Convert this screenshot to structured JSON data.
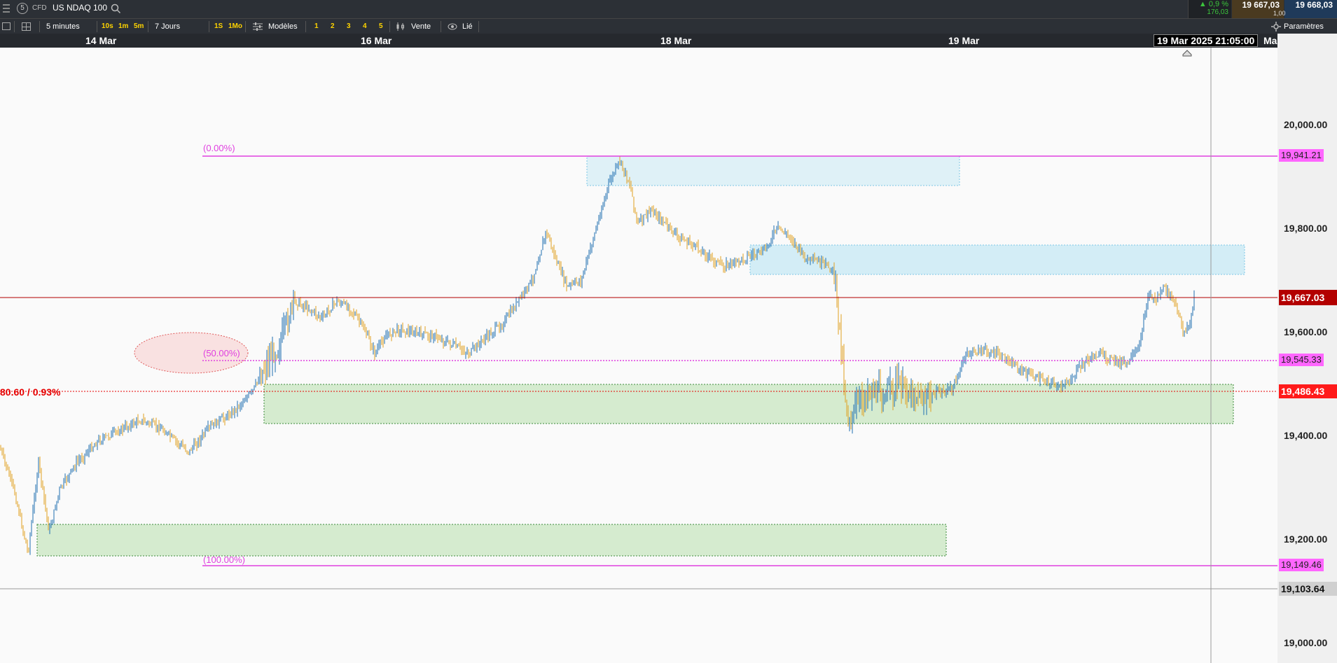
{
  "topbar": {
    "instrument_badge": "CFD",
    "instrument_name": "US NDAQ 100",
    "change_pct": "▲ 0,9 %",
    "change_abs": "176,03",
    "bid": "19 667,03",
    "spread": "1,00",
    "ask": "19 668,03",
    "number_icon": "5"
  },
  "toolbar": {
    "interval": "5 minutes",
    "quick_intervals": [
      "10s",
      "1m",
      "5m"
    ],
    "range": "7 Jours",
    "quick_ranges": [
      "1S",
      "1Mo"
    ],
    "templates_label": "Modèles",
    "template_slots": [
      "1",
      "2",
      "3",
      "4",
      "5"
    ],
    "side_label": "Vente",
    "linked_label": "Lié",
    "settings_label": "Paramètres"
  },
  "dates": {
    "d1": "14 Mar",
    "d2": "16 Mar",
    "d3": "18 Mar",
    "d4": "19 Mar",
    "d5": "Mar",
    "cursor": "19 Mar 2025 21:05:00"
  },
  "chart_data": {
    "type": "candlestick",
    "y_ticks": [
      "20,000.00",
      "19,800.00",
      "19,600.00",
      "19,400.00",
      "19,200.00",
      "19,000.00"
    ],
    "ylim": [
      18950,
      20120
    ],
    "current_price": "19,667.03",
    "cursor_price": "19,103.64",
    "fib_levels": [
      {
        "pct": "(0.00%)",
        "price": "19,941.21"
      },
      {
        "pct": "(50.00%)",
        "price": "19,545.33"
      },
      {
        "pct": "(100.00%)",
        "price": "19,149.46"
      }
    ],
    "alert_line": {
      "label": "80.60 / 0.93%",
      "price": "19,486.43"
    }
  },
  "colors": {
    "fib": "#e040e0",
    "current": "#b30000",
    "alert": "#e60000",
    "bull": "#1f6fb0",
    "bear": "#e0a020",
    "zone_blue": "#bfe6f5",
    "zone_green": "#c8e6c0"
  }
}
